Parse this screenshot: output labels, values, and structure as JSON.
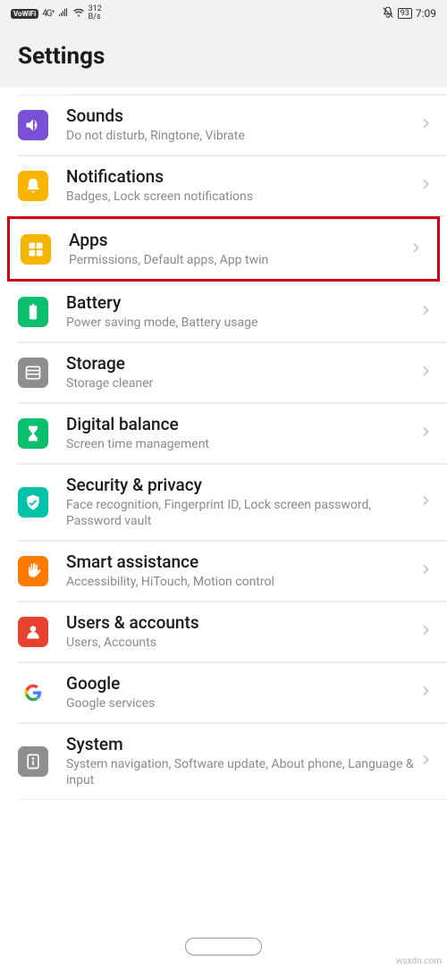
{
  "status": {
    "vowifi": "VoWiFi",
    "network": "4G⁺",
    "speed_top": "312",
    "speed_bot": "B/s",
    "battery": "93",
    "time": "7:09"
  },
  "header": {
    "title": "Settings"
  },
  "items": [
    {
      "key": "sounds",
      "title": "Sounds",
      "sub": "Do not disturb, Ringtone, Vibrate"
    },
    {
      "key": "notifications",
      "title": "Notifications",
      "sub": "Badges, Lock screen notifications"
    },
    {
      "key": "apps",
      "title": "Apps",
      "sub": "Permissions, Default apps, App twin"
    },
    {
      "key": "battery",
      "title": "Battery",
      "sub": "Power saving mode, Battery usage"
    },
    {
      "key": "storage",
      "title": "Storage",
      "sub": "Storage cleaner"
    },
    {
      "key": "digital-balance",
      "title": "Digital balance",
      "sub": "Screen time management"
    },
    {
      "key": "security",
      "title": "Security & privacy",
      "sub": "Face recognition, Fingerprint ID, Lock screen password, Password vault"
    },
    {
      "key": "smart",
      "title": "Smart assistance",
      "sub": "Accessibility, HiTouch, Motion control"
    },
    {
      "key": "users",
      "title": "Users & accounts",
      "sub": "Users, Accounts"
    },
    {
      "key": "google",
      "title": "Google",
      "sub": "Google services"
    },
    {
      "key": "system",
      "title": "System",
      "sub": "System navigation, Software update, About phone, Language & input"
    }
  ],
  "watermark": "wsxdn.com"
}
